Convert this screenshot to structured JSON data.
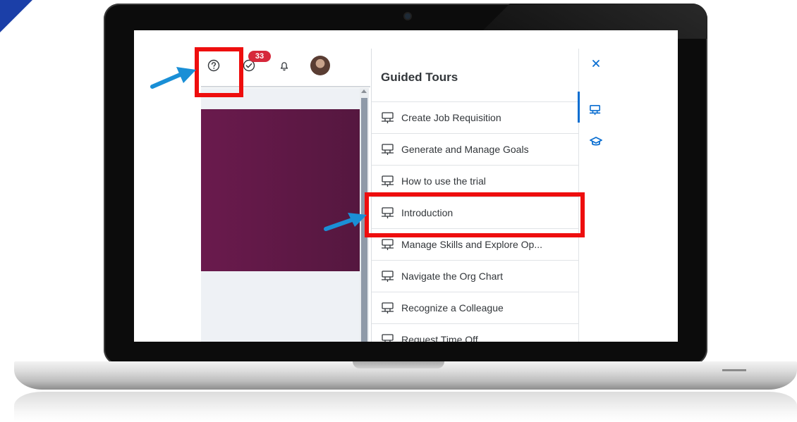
{
  "header": {
    "notification_count": "33",
    "icons": [
      "help-icon",
      "tasks-icon",
      "bell-icon",
      "avatar"
    ]
  },
  "panel": {
    "title": "Guided Tours",
    "tours": [
      {
        "label": "Create Job Requisition"
      },
      {
        "label": "Generate and Manage Goals"
      },
      {
        "label": "How to use the trial"
      },
      {
        "label": "Introduction"
      },
      {
        "label": "Manage Skills and Explore Op..."
      },
      {
        "label": "Navigate the Org Chart"
      },
      {
        "label": "Recognize a Colleague"
      },
      {
        "label": "Request Time Off"
      }
    ]
  },
  "rail": {
    "icons": [
      "close-icon",
      "guided-tours-icon",
      "learning-icon"
    ]
  },
  "colors": {
    "highlight": "#ee0e0e",
    "arrow": "#1a8fd6",
    "accent": "#0a6ed1",
    "badge": "#d6283b",
    "banner": "#6a1a4d"
  }
}
